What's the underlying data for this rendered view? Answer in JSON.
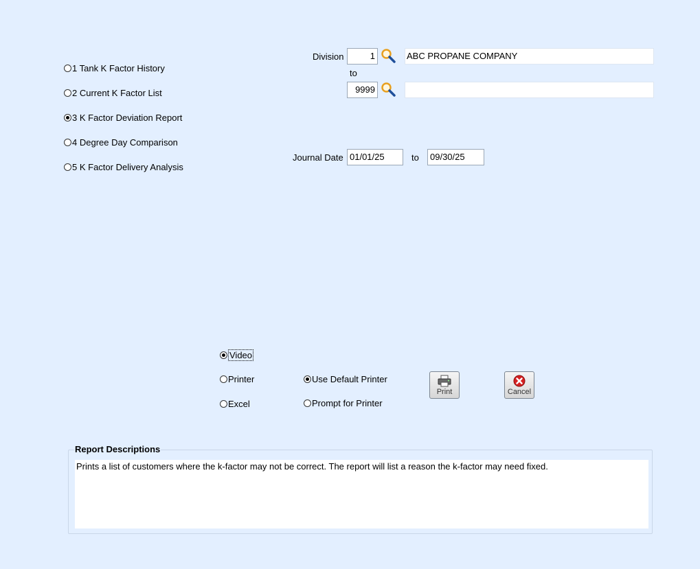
{
  "report_options": [
    {
      "label": "1 Tank K Factor History",
      "checked": false
    },
    {
      "label": "2 Current K Factor List",
      "checked": false
    },
    {
      "label": "3 K Factor Deviation Report",
      "checked": true
    },
    {
      "label": "4 Degree Day Comparison",
      "checked": false
    },
    {
      "label": "5 K Factor Delivery Analysis",
      "checked": false
    }
  ],
  "division": {
    "label": "Division",
    "from_value": "1",
    "from_name": "ABC PROPANE COMPANY",
    "to_label": "to",
    "to_value": "9999",
    "to_name": ""
  },
  "journal_date": {
    "label": "Journal Date",
    "from": "01/01/25",
    "to_label": "to",
    "to": "09/30/25"
  },
  "output": {
    "video_label": "Video",
    "printer_label": "Printer",
    "excel_label": "Excel",
    "selected": "video",
    "default_printer_label": "Use Default Printer",
    "prompt_printer_label": "Prompt for Printer",
    "printer_choice": "default"
  },
  "buttons": {
    "print_label": "Print",
    "cancel_label": "Cancel"
  },
  "report_descriptions": {
    "title": "Report Descriptions",
    "text": "Prints a list of customers where the k-factor may not be correct.  The report will list a reason the k-factor may need fixed."
  },
  "colors": {
    "background": "#e3efff",
    "lookup_icon": "#e8a020",
    "cancel_red": "#d62020"
  },
  "icons": {
    "lookup": "magnifier-icon",
    "print": "printer-icon",
    "cancel": "cancel-x-icon"
  }
}
